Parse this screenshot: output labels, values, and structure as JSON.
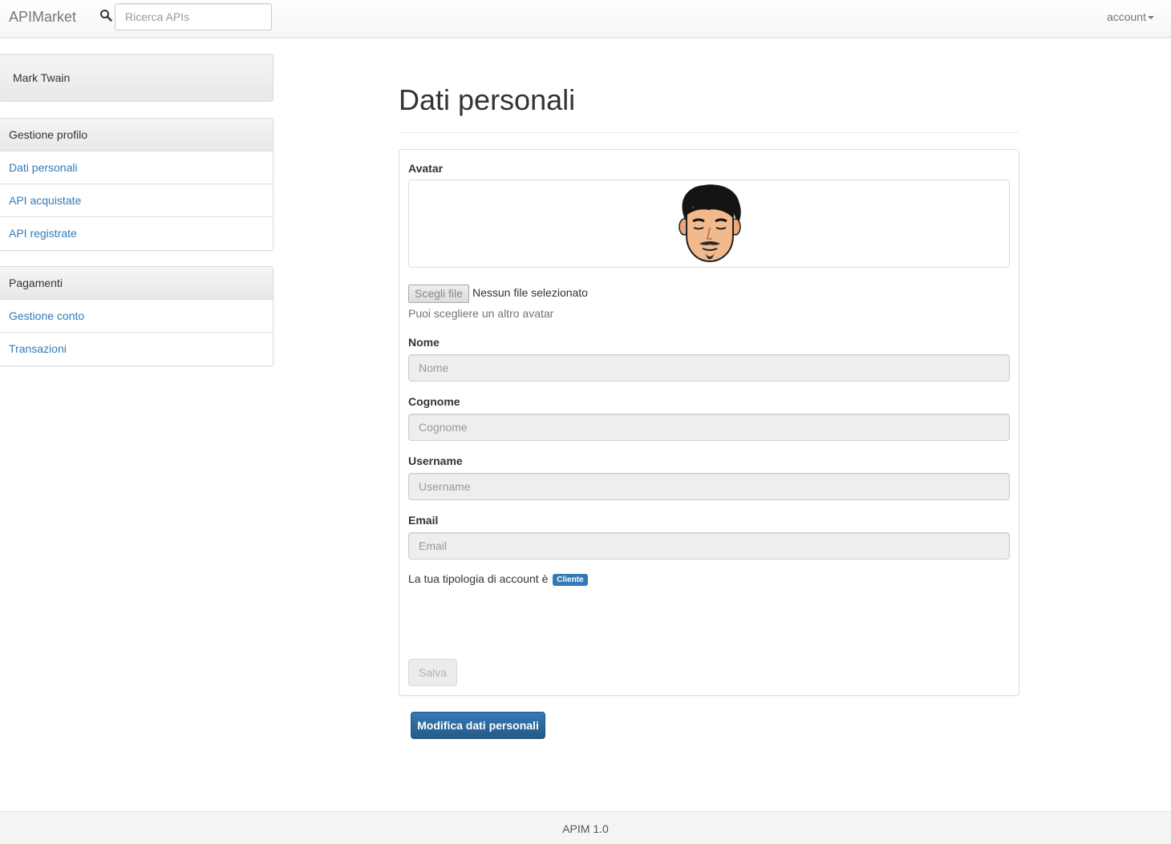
{
  "navbar": {
    "brand": "APIMarket",
    "search_icon": "search-icon",
    "search_placeholder": "Ricerca APIs",
    "search_value": "",
    "account_label": "account"
  },
  "sidebar": {
    "user_name": "Mark Twain",
    "profile_section": {
      "heading": "Gestione profilo",
      "items": [
        {
          "label": "Dati personali"
        },
        {
          "label": "API acquistate"
        },
        {
          "label": "API registrate"
        }
      ]
    },
    "payments_section": {
      "heading": "Pagamenti",
      "items": [
        {
          "label": "Gestione conto"
        },
        {
          "label": "Transazioni"
        }
      ]
    }
  },
  "main": {
    "title": "Dati personali",
    "form": {
      "avatar_label": "Avatar",
      "file_button_label": "Scegli file",
      "file_status": "Nessun file selezionato",
      "avatar_help": "Puoi scegliere un altro avatar",
      "fields": {
        "nome": {
          "label": "Nome",
          "placeholder": "Nome",
          "value": ""
        },
        "cognome": {
          "label": "Cognome",
          "placeholder": "Cognome",
          "value": ""
        },
        "username": {
          "label": "Username",
          "placeholder": "Username",
          "value": ""
        },
        "email": {
          "label": "Email",
          "placeholder": "Email",
          "value": ""
        }
      },
      "account_type_text": "La tua tipologia di account è",
      "account_type_badge": "Cliente",
      "save_label": "Salva"
    },
    "edit_button_label": "Modifica dati personali"
  },
  "footer": {
    "text": "APIM 1.0"
  },
  "colors": {
    "link": "#337ab7",
    "primary": "#337ab7",
    "badge": "#337ab7"
  }
}
